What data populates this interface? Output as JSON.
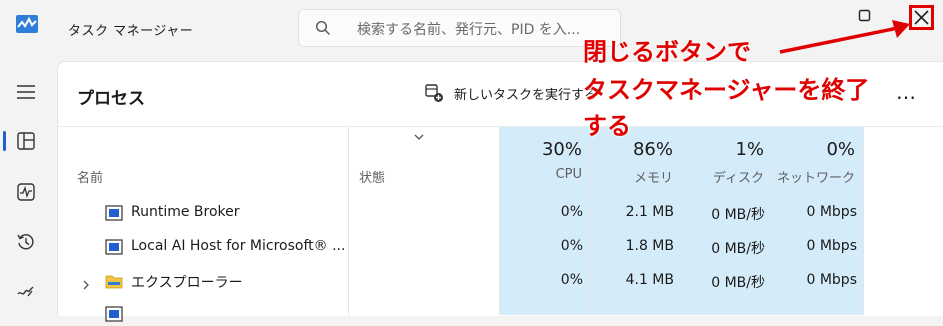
{
  "window": {
    "title": "タスク マネージャー",
    "search_placeholder": "検索する名前、発行元、PID を入..."
  },
  "nav": {
    "items": [
      "menu-icon",
      "processes-icon",
      "performance-icon",
      "app-history-icon",
      "startup-apps-icon"
    ],
    "active": "processes-icon"
  },
  "toolbar": {
    "page_title": "プロセス",
    "new_task_label": "新しいタスクを実行する",
    "more_label": "…"
  },
  "table": {
    "name_header": "名前",
    "status_header": "状態",
    "columns": [
      {
        "percent": "30%",
        "label": "CPU"
      },
      {
        "percent": "86%",
        "label": "メモリ"
      },
      {
        "percent": "1%",
        "label": "ディスク"
      },
      {
        "percent": "0%",
        "label": "ネットワーク"
      }
    ],
    "rows": [
      {
        "name": "Runtime Broker",
        "icon": "app-window-icon",
        "expandable": false,
        "cpu": "0%",
        "memory": "2.1 MB",
        "disk": "0 MB/秒",
        "network": "0 Mbps"
      },
      {
        "name": "Local AI Host for Microsoft® ...",
        "icon": "app-window-icon",
        "expandable": false,
        "cpu": "0%",
        "memory": "1.8 MB",
        "disk": "0 MB/秒",
        "network": "0 Mbps"
      },
      {
        "name": "エクスプローラー",
        "icon": "folder-icon",
        "expandable": true,
        "cpu": "0%",
        "memory": "4.1 MB",
        "disk": "0 MB/秒",
        "network": "0 Mbps"
      }
    ]
  },
  "annotation": {
    "line1": "閉じるボタンで",
    "line2": "タスクマネージャーを終了",
    "line3": "する",
    "color": "#e00000"
  },
  "colors": {
    "accent": "#1f5fd0",
    "highlight": "#d4ecf9",
    "annotation": "#e00000"
  }
}
